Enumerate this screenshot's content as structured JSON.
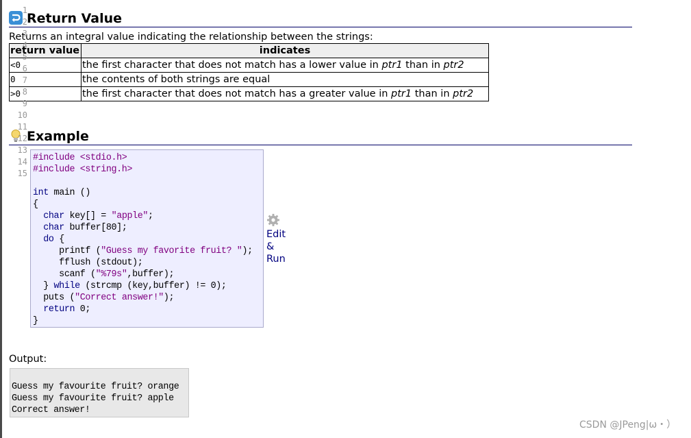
{
  "return_value": {
    "heading": "Return Value",
    "icon": "return-arrow-icon",
    "intro": "Returns an integral value indicating the relationship between the strings:",
    "table": {
      "headers": [
        "return value",
        "indicates"
      ],
      "rows": [
        {
          "value": "<0",
          "pre": "the first character that does not match has a lower value in ",
          "a": "ptr1",
          "mid": " than in ",
          "b": "ptr2"
        },
        {
          "value": "0",
          "text": "the contents of both strings are equal"
        },
        {
          "value": ">0",
          "pre": "the first character that does not match has a greater value in ",
          "a": "ptr1",
          "mid": " than in ",
          "b": "ptr2"
        }
      ]
    }
  },
  "example": {
    "heading": "Example",
    "icon": "lightbulb-icon",
    "line_numbers": [
      "1",
      "2",
      "3",
      "4",
      "5",
      "6",
      "7",
      "8",
      "9",
      "10",
      "11",
      "12",
      "13",
      "14",
      "15"
    ],
    "code_lines": [
      [
        {
          "t": "#include <stdio.h>",
          "c": "pp"
        }
      ],
      [
        {
          "t": "#include <string.h>",
          "c": "pp"
        }
      ],
      [
        {
          "t": ""
        }
      ],
      [
        {
          "t": "int",
          "c": "kw"
        },
        {
          "t": " main ()"
        }
      ],
      [
        {
          "t": "{"
        }
      ],
      [
        {
          "t": "  "
        },
        {
          "t": "char",
          "c": "kw"
        },
        {
          "t": " key[] = "
        },
        {
          "t": "\"apple\"",
          "c": "str"
        },
        {
          "t": ";"
        }
      ],
      [
        {
          "t": "  "
        },
        {
          "t": "char",
          "c": "kw"
        },
        {
          "t": " buffer[80];"
        }
      ],
      [
        {
          "t": "  "
        },
        {
          "t": "do",
          "c": "kw"
        },
        {
          "t": " {"
        }
      ],
      [
        {
          "t": "     printf ("
        },
        {
          "t": "\"Guess my favorite fruit? \"",
          "c": "str"
        },
        {
          "t": ");"
        }
      ],
      [
        {
          "t": "     fflush (stdout);"
        }
      ],
      [
        {
          "t": "     scanf ("
        },
        {
          "t": "\"%79s\"",
          "c": "str"
        },
        {
          "t": ",buffer);"
        }
      ],
      [
        {
          "t": "  } "
        },
        {
          "t": "while",
          "c": "kw"
        },
        {
          "t": " (strcmp (key,buffer) != 0);"
        }
      ],
      [
        {
          "t": "  puts ("
        },
        {
          "t": "\"Correct answer!\"",
          "c": "str"
        },
        {
          "t": ");"
        }
      ],
      [
        {
          "t": "  "
        },
        {
          "t": "return",
          "c": "kw"
        },
        {
          "t": " 0;"
        }
      ],
      [
        {
          "t": "}"
        }
      ]
    ],
    "edit_run": {
      "icon": "gear-icon",
      "line1": "Edit",
      "line2": "&",
      "line3": "Run"
    }
  },
  "output": {
    "label": "Output:",
    "lines": [
      "Guess my favourite fruit? orange",
      "Guess my favourite fruit? apple",
      "Correct answer!"
    ]
  },
  "watermark": "CSDN @JPeng|ω・）",
  "colors": {
    "keyword": "#000080",
    "string": "#800080",
    "code_bg": "#eeeeff",
    "output_bg": "#e8e8e8",
    "heading_rule": "#000066"
  }
}
